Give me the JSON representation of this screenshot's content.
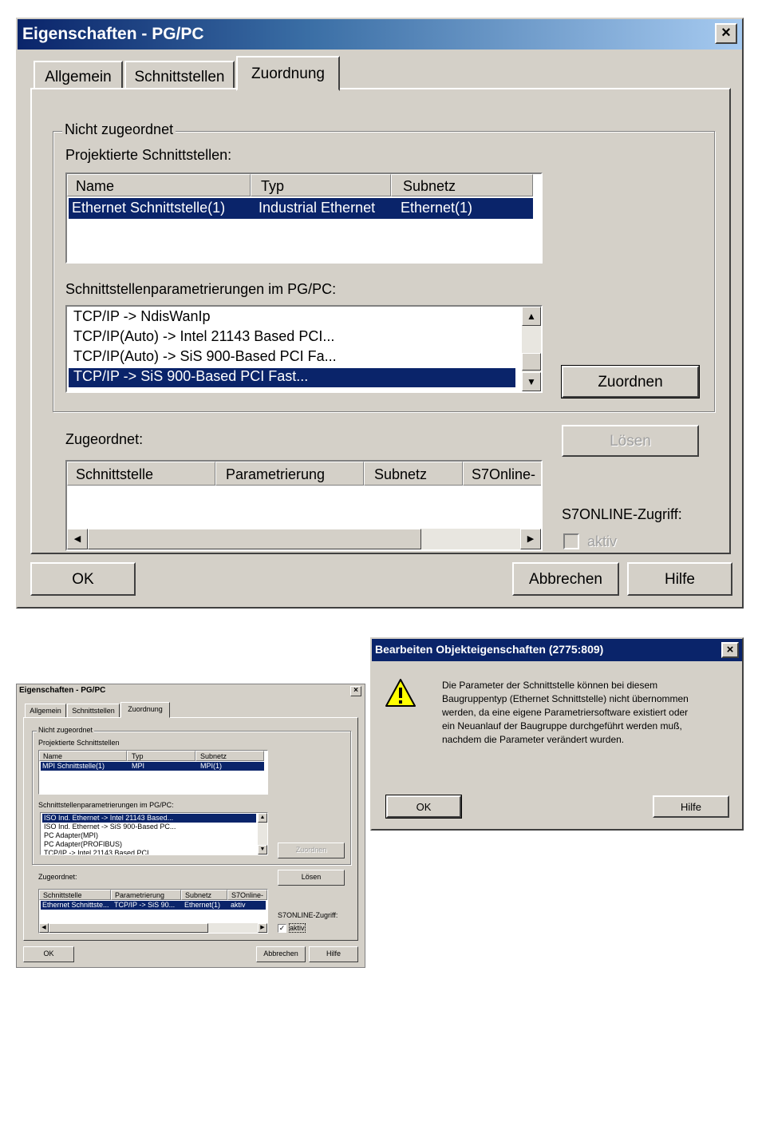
{
  "big": {
    "title": "Eigenschaften - PG/PC",
    "close": "×",
    "tabs": [
      "Allgemein",
      "Schnittstellen",
      "Zuordnung"
    ],
    "group_title": "Nicht zugeordnet",
    "projected_label": "Projektierte Schnittstellen:",
    "proj_headers": [
      "Name",
      "Typ",
      "Subnetz"
    ],
    "proj_rows": [
      [
        "Ethernet Schnittstelle(1)",
        "Industrial Ethernet",
        "Ethernet(1)"
      ]
    ],
    "param_label": "Schnittstellenparametrierungen im PG/PC:",
    "param_items": [
      "TCP/IP -> NdisWanIp",
      "TCP/IP(Auto) -> Intel 21143 Based PCI...",
      "TCP/IP(Auto) -> SiS 900-Based PCI Fa...",
      "TCP/IP -> SiS 900-Based PCI Fast..."
    ],
    "assign_button": "Zuordnen",
    "assigned_label": "Zugeordnet:",
    "release_button": "Lösen",
    "assigned_headers": [
      "Schnittstelle",
      "Parametrierung",
      "Subnetz",
      "S7Online-"
    ],
    "online_label": "S7ONLINE-Zugriff:",
    "active_label": "aktiv",
    "ok": "OK",
    "cancel": "Abbrechen",
    "help": "Hilfe"
  },
  "small": {
    "title": "Eigenschaften - PG/PC",
    "close": "×",
    "tabs": [
      "Allgemein",
      "Schnittstellen",
      "Zuordnung"
    ],
    "group_title": "Nicht zugeordnet",
    "projected_label": "Projektierte Schnittstellen",
    "proj_headers": [
      "Name",
      "Typ",
      "Subnetz"
    ],
    "proj_rows": [
      [
        "MPI Schnittstelle(1)",
        "MPI",
        "MPI(1)"
      ]
    ],
    "param_label": "Schnittstellenparametrierungen im PG/PC:",
    "param_items": [
      "ISO Ind. Ethernet -> Intel 21143 Based...",
      "ISO Ind. Ethernet -> SiS 900-Based PC...",
      "PC Adapter(MPI)",
      "PC Adapter(PROFIBUS)",
      "TCP/IP -> Intel 21143 Based PCI..."
    ],
    "assign_button": "Zuordnen",
    "assigned_label": "Zugeordnet:",
    "release_button": "Lösen",
    "assigned_headers": [
      "Schnittstelle",
      "Parametrierung",
      "Subnetz",
      "S7Online-"
    ],
    "assigned_rows": [
      [
        "Ethernet Schnittste...",
        "TCP/IP -> SiS 90...",
        "Ethernet(1)",
        "aktiv"
      ]
    ],
    "online_label": "S7ONLINE-Zugriff:",
    "active_label": "aktiv",
    "ok": "OK",
    "cancel": "Abbrechen",
    "help": "Hilfe"
  },
  "msg": {
    "title": "Bearbeiten Objekteigenschaften (2775:809)",
    "close": "×",
    "icon": "warning-icon",
    "lines": [
      "Die Parameter der Schnittstelle können bei diesem",
      "Baugruppentyp (Ethernet Schnittstelle) nicht übernommen",
      "werden, da eine eigene Parametriersoftware existiert oder",
      "ein Neuanlauf der Baugruppe durchgeführt werden muß,",
      "nachdem die Parameter verändert wurden."
    ],
    "ok": "OK",
    "help": "Hilfe"
  }
}
